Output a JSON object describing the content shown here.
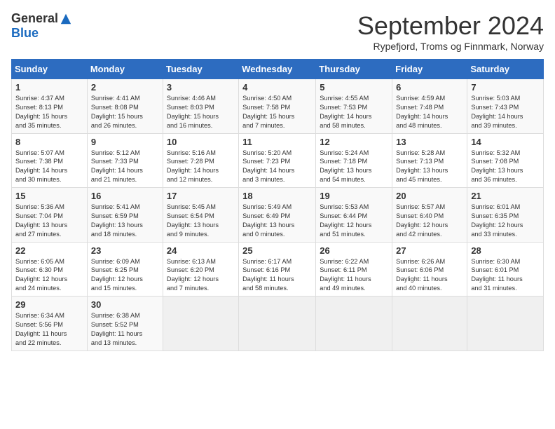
{
  "header": {
    "logo_general": "General",
    "logo_blue": "Blue",
    "month_title": "September 2024",
    "location": "Rypefjord, Troms og Finnmark, Norway"
  },
  "days_of_week": [
    "Sunday",
    "Monday",
    "Tuesday",
    "Wednesday",
    "Thursday",
    "Friday",
    "Saturday"
  ],
  "weeks": [
    [
      {
        "day": "1",
        "info": "Sunrise: 4:37 AM\nSunset: 8:13 PM\nDaylight: 15 hours\nand 35 minutes."
      },
      {
        "day": "2",
        "info": "Sunrise: 4:41 AM\nSunset: 8:08 PM\nDaylight: 15 hours\nand 26 minutes."
      },
      {
        "day": "3",
        "info": "Sunrise: 4:46 AM\nSunset: 8:03 PM\nDaylight: 15 hours\nand 16 minutes."
      },
      {
        "day": "4",
        "info": "Sunrise: 4:50 AM\nSunset: 7:58 PM\nDaylight: 15 hours\nand 7 minutes."
      },
      {
        "day": "5",
        "info": "Sunrise: 4:55 AM\nSunset: 7:53 PM\nDaylight: 14 hours\nand 58 minutes."
      },
      {
        "day": "6",
        "info": "Sunrise: 4:59 AM\nSunset: 7:48 PM\nDaylight: 14 hours\nand 48 minutes."
      },
      {
        "day": "7",
        "info": "Sunrise: 5:03 AM\nSunset: 7:43 PM\nDaylight: 14 hours\nand 39 minutes."
      }
    ],
    [
      {
        "day": "8",
        "info": "Sunrise: 5:07 AM\nSunset: 7:38 PM\nDaylight: 14 hours\nand 30 minutes."
      },
      {
        "day": "9",
        "info": "Sunrise: 5:12 AM\nSunset: 7:33 PM\nDaylight: 14 hours\nand 21 minutes."
      },
      {
        "day": "10",
        "info": "Sunrise: 5:16 AM\nSunset: 7:28 PM\nDaylight: 14 hours\nand 12 minutes."
      },
      {
        "day": "11",
        "info": "Sunrise: 5:20 AM\nSunset: 7:23 PM\nDaylight: 14 hours\nand 3 minutes."
      },
      {
        "day": "12",
        "info": "Sunrise: 5:24 AM\nSunset: 7:18 PM\nDaylight: 13 hours\nand 54 minutes."
      },
      {
        "day": "13",
        "info": "Sunrise: 5:28 AM\nSunset: 7:13 PM\nDaylight: 13 hours\nand 45 minutes."
      },
      {
        "day": "14",
        "info": "Sunrise: 5:32 AM\nSunset: 7:08 PM\nDaylight: 13 hours\nand 36 minutes."
      }
    ],
    [
      {
        "day": "15",
        "info": "Sunrise: 5:36 AM\nSunset: 7:04 PM\nDaylight: 13 hours\nand 27 minutes."
      },
      {
        "day": "16",
        "info": "Sunrise: 5:41 AM\nSunset: 6:59 PM\nDaylight: 13 hours\nand 18 minutes."
      },
      {
        "day": "17",
        "info": "Sunrise: 5:45 AM\nSunset: 6:54 PM\nDaylight: 13 hours\nand 9 minutes."
      },
      {
        "day": "18",
        "info": "Sunrise: 5:49 AM\nSunset: 6:49 PM\nDaylight: 13 hours\nand 0 minutes."
      },
      {
        "day": "19",
        "info": "Sunrise: 5:53 AM\nSunset: 6:44 PM\nDaylight: 12 hours\nand 51 minutes."
      },
      {
        "day": "20",
        "info": "Sunrise: 5:57 AM\nSunset: 6:40 PM\nDaylight: 12 hours\nand 42 minutes."
      },
      {
        "day": "21",
        "info": "Sunrise: 6:01 AM\nSunset: 6:35 PM\nDaylight: 12 hours\nand 33 minutes."
      }
    ],
    [
      {
        "day": "22",
        "info": "Sunrise: 6:05 AM\nSunset: 6:30 PM\nDaylight: 12 hours\nand 24 minutes."
      },
      {
        "day": "23",
        "info": "Sunrise: 6:09 AM\nSunset: 6:25 PM\nDaylight: 12 hours\nand 15 minutes."
      },
      {
        "day": "24",
        "info": "Sunrise: 6:13 AM\nSunset: 6:20 PM\nDaylight: 12 hours\nand 7 minutes."
      },
      {
        "day": "25",
        "info": "Sunrise: 6:17 AM\nSunset: 6:16 PM\nDaylight: 11 hours\nand 58 minutes."
      },
      {
        "day": "26",
        "info": "Sunrise: 6:22 AM\nSunset: 6:11 PM\nDaylight: 11 hours\nand 49 minutes."
      },
      {
        "day": "27",
        "info": "Sunrise: 6:26 AM\nSunset: 6:06 PM\nDaylight: 11 hours\nand 40 minutes."
      },
      {
        "day": "28",
        "info": "Sunrise: 6:30 AM\nSunset: 6:01 PM\nDaylight: 11 hours\nand 31 minutes."
      }
    ],
    [
      {
        "day": "29",
        "info": "Sunrise: 6:34 AM\nSunset: 5:56 PM\nDaylight: 11 hours\nand 22 minutes."
      },
      {
        "day": "30",
        "info": "Sunrise: 6:38 AM\nSunset: 5:52 PM\nDaylight: 11 hours\nand 13 minutes."
      },
      {
        "day": "",
        "info": ""
      },
      {
        "day": "",
        "info": ""
      },
      {
        "day": "",
        "info": ""
      },
      {
        "day": "",
        "info": ""
      },
      {
        "day": "",
        "info": ""
      }
    ]
  ]
}
